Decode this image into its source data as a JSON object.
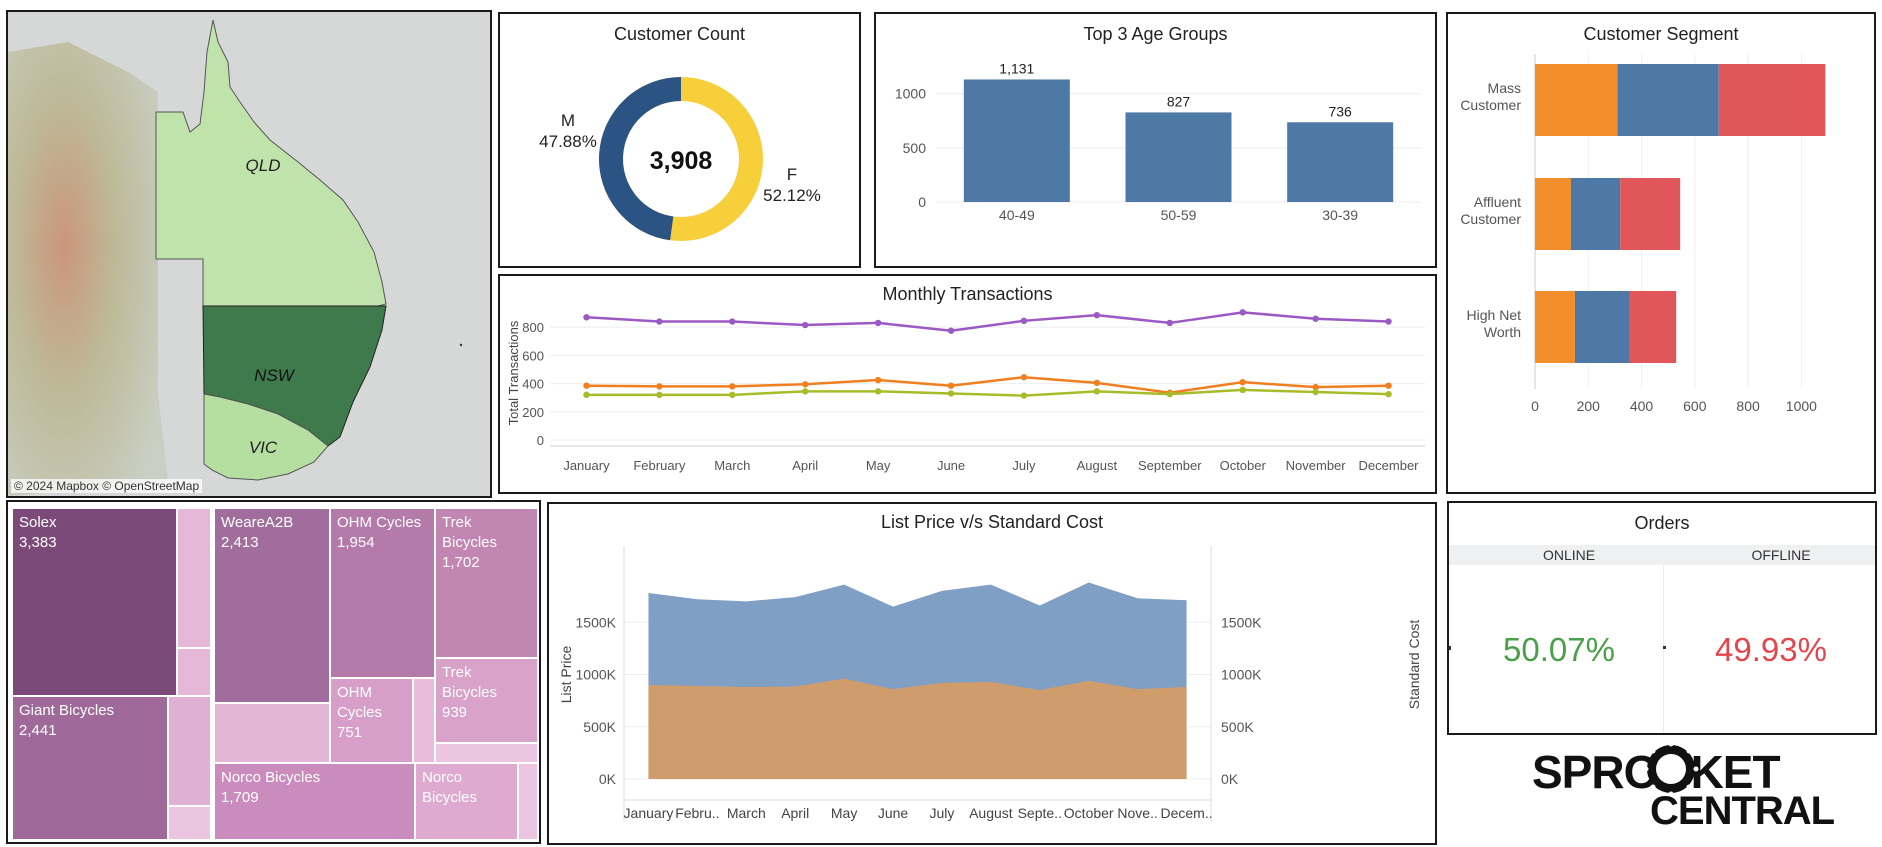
{
  "map": {
    "regions": [
      "QLD",
      "NSW",
      "VIC"
    ],
    "attribution": "© 2024 Mapbox © OpenStreetMap",
    "colors": {
      "sea": "#d6d8d6",
      "land": "#b9c9a4",
      "qld": "#bfe3ab",
      "nsw": "#3f7a4d",
      "vic": "#b5dfa0"
    }
  },
  "customer_count": {
    "title": "Customer Count",
    "total": "3,908",
    "m_label": "M",
    "m_pct": "47.88%",
    "f_label": "F",
    "f_pct": "52.12%",
    "colors": {
      "m": "#2b5384",
      "f": "#f6cf3b"
    }
  },
  "orders": {
    "title": "Orders",
    "online_label": "ONLINE",
    "offline_label": "OFFLINE",
    "online_value": "50.07%",
    "offline_value": "49.93%",
    "colors": {
      "online": "#4aa04a",
      "offline": "#e2474d"
    }
  },
  "logo": {
    "line1": "SPROCKET",
    "line2": "CENTRAL"
  },
  "chart_data": [
    {
      "id": "age",
      "type": "bar",
      "title": "Top 3 Age Groups",
      "categories": [
        "40-49",
        "50-59",
        "30-39"
      ],
      "values": [
        1131,
        827,
        736
      ],
      "value_labels": [
        "1,131",
        "827",
        "736"
      ],
      "ylim": [
        0,
        1200
      ],
      "yticks": [
        0,
        500,
        1000
      ],
      "ytick_labels": [
        "0",
        "500",
        "1000"
      ],
      "color": "#4e79a7",
      "grid": true
    },
    {
      "id": "segment",
      "type": "bar",
      "orientation": "horizontal",
      "stacked": true,
      "title": "Customer Segment",
      "categories": [
        "Mass Customer",
        "Affluent Customer",
        "High Net Worth"
      ],
      "category_lines": [
        [
          "Mass",
          "Customer"
        ],
        [
          "Affluent",
          "Customer"
        ],
        [
          "High Net",
          "Worth"
        ]
      ],
      "series": [
        {
          "values": [
            310,
            135,
            150
          ],
          "color": "#f28e2b"
        },
        {
          "values": [
            380,
            185,
            205
          ],
          "color": "#4e79a7"
        },
        {
          "values": [
            400,
            225,
            175
          ],
          "color": "#e15759"
        }
      ],
      "xlim": [
        0,
        1100
      ],
      "xticks": [
        0,
        200,
        400,
        600,
        800,
        1000
      ],
      "xtick_labels": [
        "0",
        "200",
        "400",
        "600",
        "800",
        "1000"
      ]
    },
    {
      "id": "monthly",
      "type": "line",
      "title": "Monthly Transactions",
      "ylabel": "Total Transactions",
      "categories": [
        "January",
        "February",
        "March",
        "April",
        "May",
        "June",
        "July",
        "August",
        "September",
        "October",
        "November",
        "December"
      ],
      "series": [
        {
          "color": "#9b59c4",
          "values": [
            870,
            840,
            840,
            815,
            830,
            775,
            845,
            885,
            830,
            905,
            860,
            840
          ]
        },
        {
          "color": "#f07f22",
          "values": [
            385,
            380,
            380,
            395,
            425,
            385,
            445,
            405,
            335,
            410,
            375,
            385
          ]
        },
        {
          "color": "#a8bc2a",
          "values": [
            320,
            320,
            320,
            345,
            345,
            330,
            315,
            345,
            325,
            355,
            340,
            325
          ]
        }
      ],
      "ylim": [
        0,
        950
      ],
      "yticks": [
        0,
        200,
        400,
        600,
        800
      ],
      "ytick_labels": [
        "0",
        "200",
        "400",
        "600",
        "800"
      ],
      "grid": true
    },
    {
      "id": "price",
      "type": "area",
      "title": "List Price v/s Standard Cost",
      "ylabel": "List Price",
      "y2label": "Standard Cost",
      "categories": [
        "January",
        "Febru..",
        "March",
        "April",
        "May",
        "June",
        "July",
        "August",
        "Septe..",
        "October",
        "Nove..",
        "Decem.."
      ],
      "series": [
        {
          "name": "List Price",
          "color": "#7f9fc4",
          "values": [
            1780000,
            1720000,
            1700000,
            1740000,
            1860000,
            1650000,
            1800000,
            1860000,
            1660000,
            1880000,
            1730000,
            1710000
          ]
        },
        {
          "name": "Standard Cost",
          "color": "#cf9c6b",
          "values": [
            900000,
            890000,
            880000,
            885000,
            960000,
            860000,
            920000,
            930000,
            850000,
            940000,
            860000,
            880000
          ]
        }
      ],
      "ylim": [
        0,
        2000000
      ],
      "yticks": [
        0,
        500000,
        1000000,
        1500000
      ],
      "ytick_labels": [
        "0K",
        "500K",
        "1000K",
        "1500K"
      ],
      "grid": true
    },
    {
      "id": "brands",
      "type": "treemap",
      "labeled_tiles": [
        {
          "name": "Solex",
          "value": "3,383"
        },
        {
          "name": "WeareA2B",
          "value": "2,413"
        },
        {
          "name": "OHM Cycles",
          "value": "1,954"
        },
        {
          "name": "Trek Bicycles",
          "value": "1,702"
        },
        {
          "name": "Giant Bicycles",
          "value": "2,441"
        },
        {
          "name": "OHM Cycles",
          "value": "751"
        },
        {
          "name": "Trek Bicycles",
          "value": "939"
        },
        {
          "name": "Norco Bicycles",
          "value": "1,709"
        },
        {
          "name": "Norco Bicycles"
        }
      ]
    }
  ]
}
